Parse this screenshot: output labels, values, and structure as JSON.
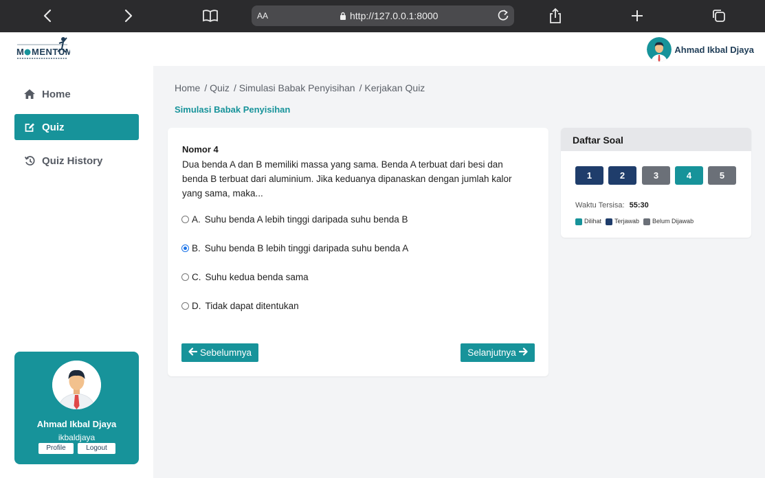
{
  "browser": {
    "text_size_label": "AA",
    "url": "http://127.0.0.1:8000"
  },
  "header": {
    "user_name": "Ahmad Ikbal Djaya"
  },
  "sidebar": {
    "items": [
      {
        "label": "Home",
        "icon": "home-icon"
      },
      {
        "label": "Quiz",
        "icon": "edit-icon"
      },
      {
        "label": "Quiz History",
        "icon": "history-icon"
      }
    ],
    "profile": {
      "name": "Ahmad Ikbal Djaya",
      "username": "ikbaldjaya",
      "profile_label": "Profile",
      "logout_label": "Logout"
    }
  },
  "breadcrumb": [
    "Home",
    "/ Quiz",
    "/ Simulasi Babak Penyisihan",
    "/ Kerjakan Quiz"
  ],
  "page_title": "Simulasi Babak Penyisihan",
  "question": {
    "number_label": "Nomor 4",
    "text": "Dua benda A dan B memiliki massa yang sama. Benda A terbuat dari besi dan benda B terbuat dari aluminium. Jika keduanya dipanaskan dengan jumlah kalor yang sama, maka...",
    "options": [
      {
        "letter": "A.",
        "text": "Suhu benda A lebih tinggi daripada suhu benda B",
        "selected": false
      },
      {
        "letter": "B.",
        "text": "Suhu benda B lebih tinggi daripada suhu benda A",
        "selected": true
      },
      {
        "letter": "C.",
        "text": "Suhu kedua benda sama",
        "selected": false
      },
      {
        "letter": "D.",
        "text": "Tidak dapat ditentukan",
        "selected": false
      }
    ],
    "prev_label": "Sebelumnya",
    "next_label": "Selanjutnya"
  },
  "question_list": {
    "title": "Daftar Soal",
    "buttons": [
      {
        "label": "1",
        "status": "answered"
      },
      {
        "label": "2",
        "status": "answered"
      },
      {
        "label": "3",
        "status": "unanswered"
      },
      {
        "label": "4",
        "status": "viewed"
      },
      {
        "label": "5",
        "status": "unanswered"
      }
    ],
    "timer_label": "Waktu Tersisa:",
    "timer_value": "55:30",
    "legend": [
      {
        "label": "Dilihat",
        "color": "#17939a"
      },
      {
        "label": "Terjawab",
        "color": "#1f3d6b"
      },
      {
        "label": "Belum Dijawab",
        "color": "#6b7078"
      }
    ]
  },
  "colors": {
    "accent": "#17939a",
    "answered": "#1f3d6b",
    "unanswered": "#6b7078"
  }
}
